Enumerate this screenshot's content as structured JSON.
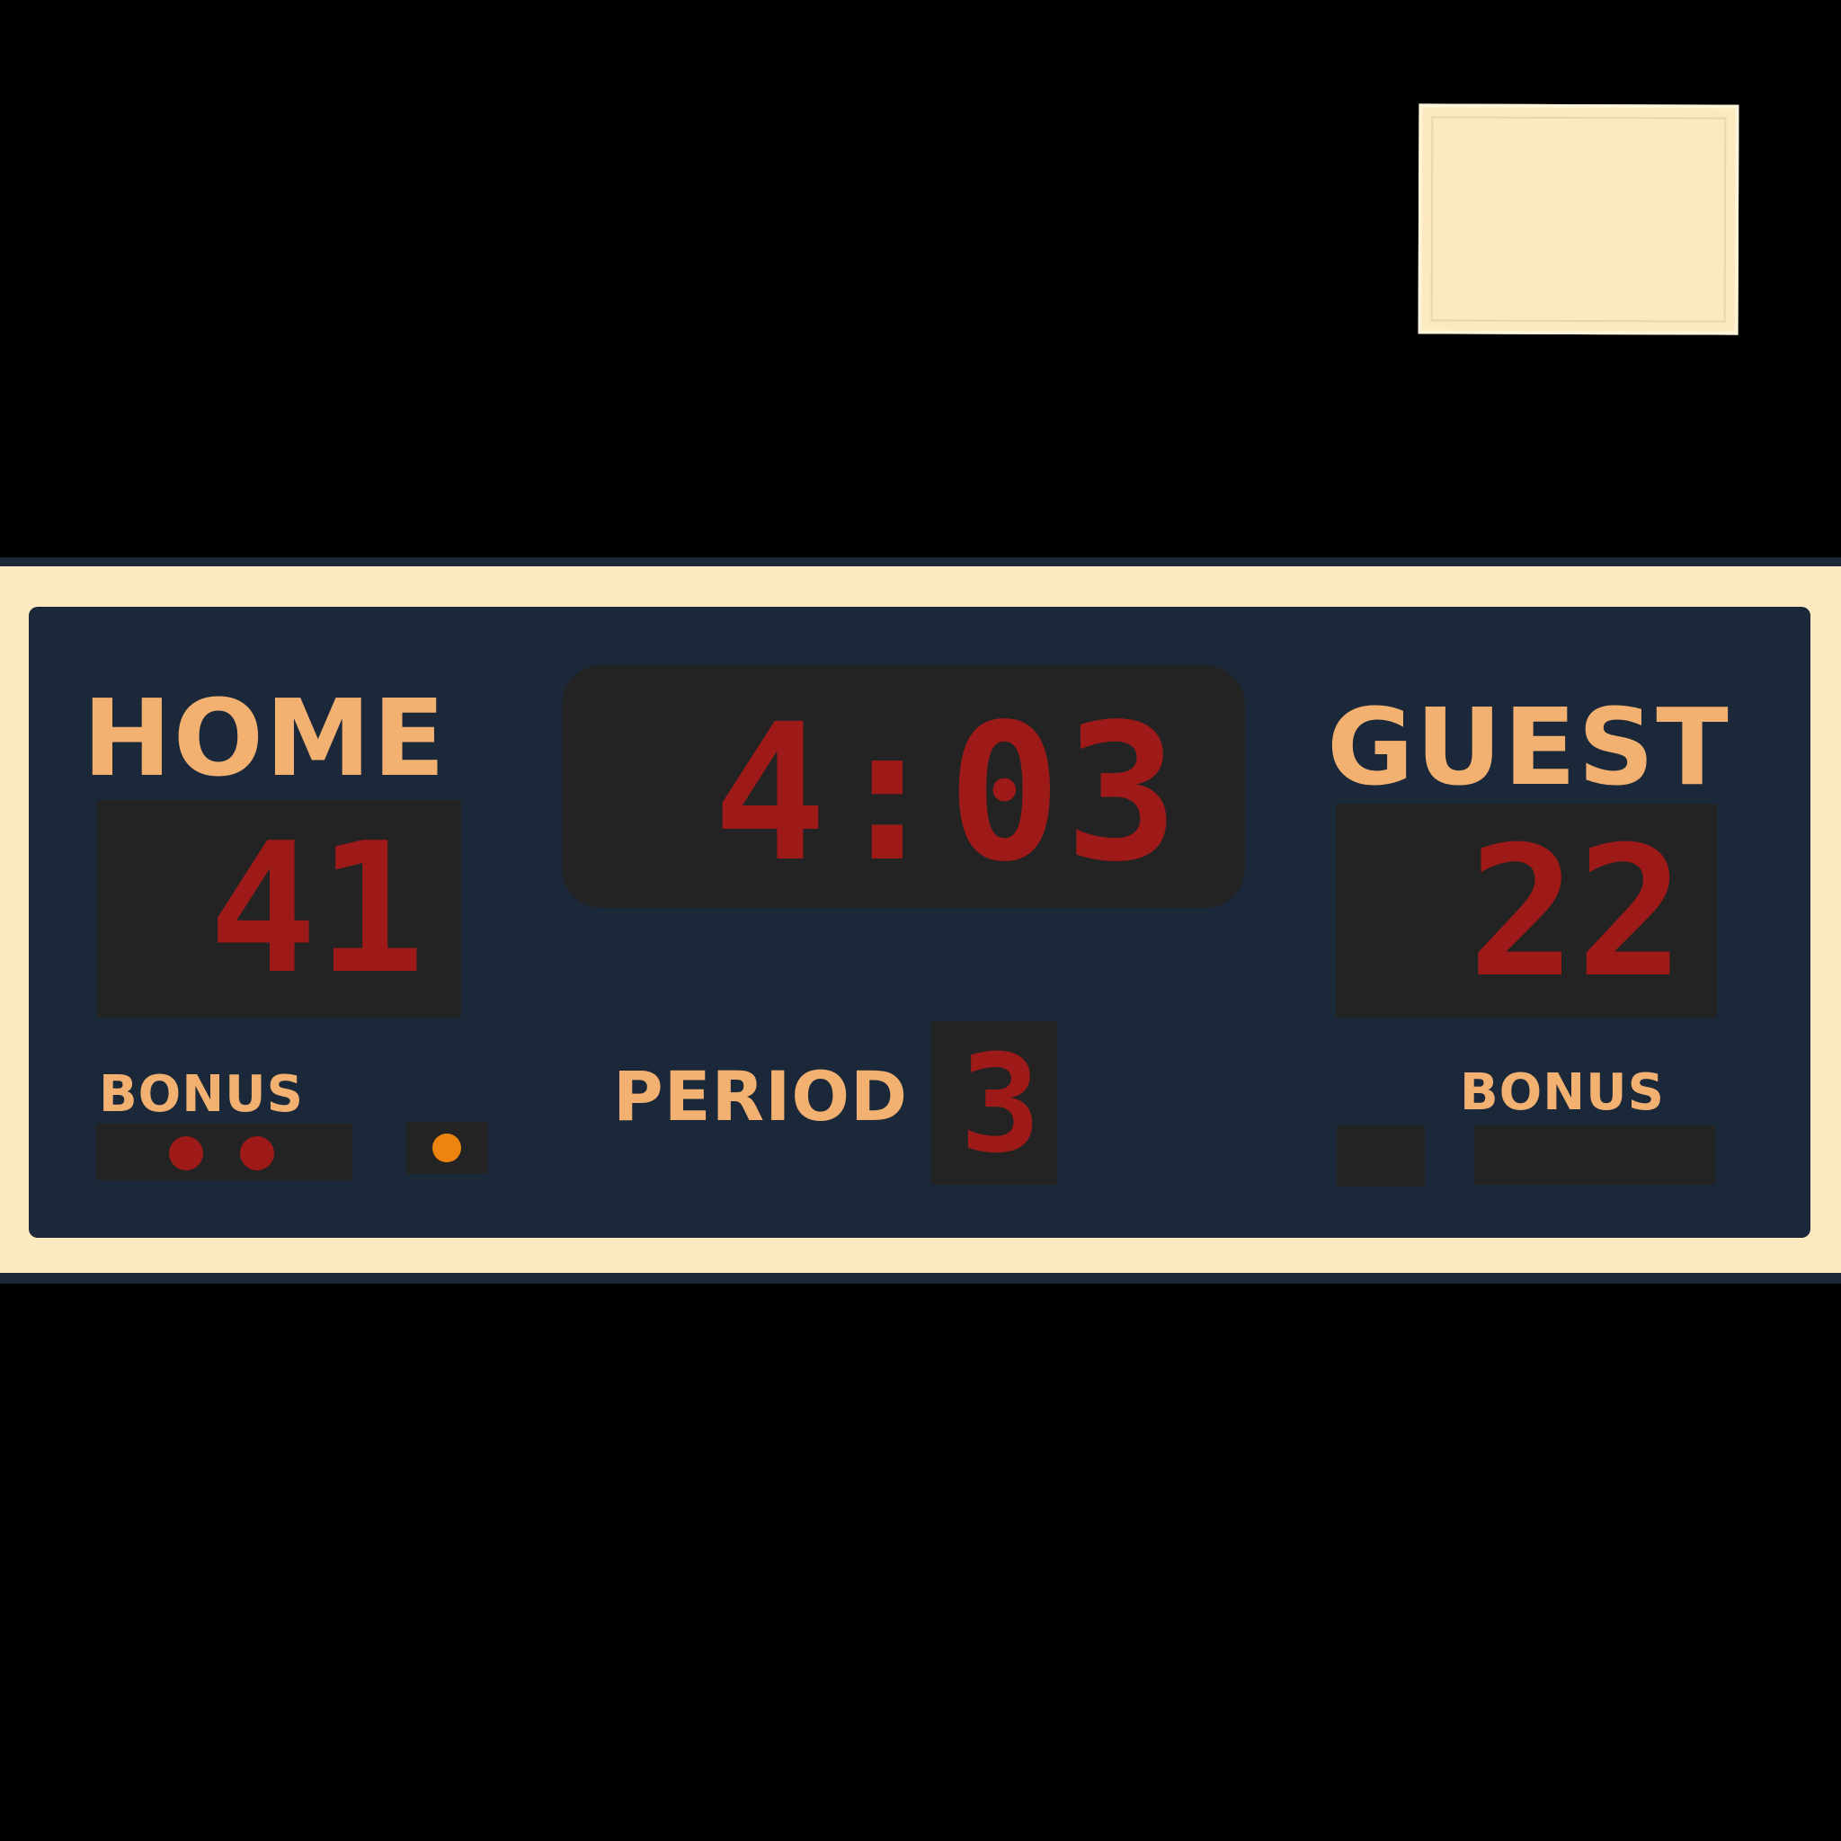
{
  "scoreboard": {
    "home": {
      "label": "HOME",
      "score": "41",
      "bonus_label": "BONUS",
      "bonus_lights_on": 2,
      "possession": true
    },
    "guest": {
      "label": "GUEST",
      "score": "22",
      "bonus_label": "BONUS",
      "bonus_lights_on": 0,
      "possession": false
    },
    "clock": "4:03",
    "period_label": "PERIOD",
    "period": "3"
  },
  "colors": {
    "background": "#000000",
    "frame": "#fde9c0",
    "panel": "#1a2839",
    "label": "#f2b071",
    "display": "#232323",
    "led_red": "#9e1a18",
    "led_orange": "#ee8410"
  }
}
